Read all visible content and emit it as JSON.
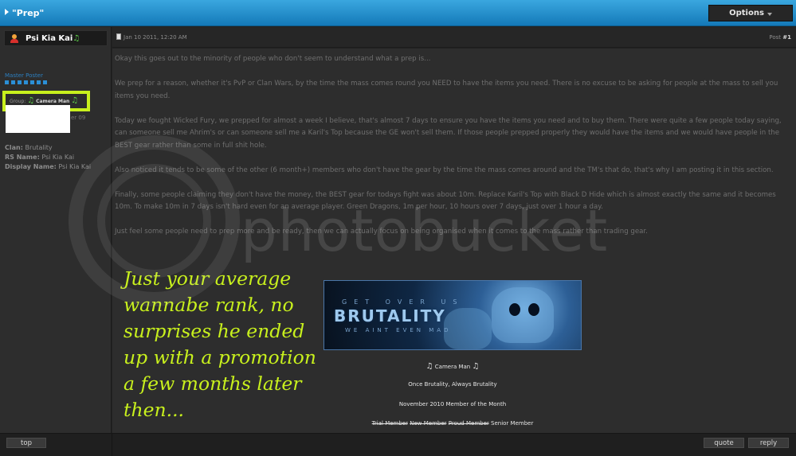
{
  "thread": {
    "title": "\"Prep\"",
    "options_label": "Options"
  },
  "user": {
    "name": "Psi Kia Kai",
    "title": "Master Poster",
    "group_label": "Group:",
    "group_value": "Camera Man",
    "joined_fragment": "er 09",
    "clan_label": "Clan:",
    "clan_value": "Brutality",
    "rs_label": "RS Name:",
    "rs_value": "Psi Kia Kai",
    "display_label": "Display Name:",
    "display_value": "Psi Kia Kai"
  },
  "post": {
    "date": "Jan 10 2011, 12:20 AM",
    "number_label": "Post",
    "number_value": "#1",
    "paragraphs": [
      "Okay this goes out to the minority of people who don't seem to understand what a prep is...",
      "We prep for a reason, whether it's PvP or Clan Wars, by the time the mass comes round you NEED to have the items you need. There is no excuse to be asking for people at the mass to sell you items you need.",
      "Today we fought Wicked Fury, we prepped for almost a week I believe, that's almost 7 days to ensure you have the items you need and to buy them. There were quite a few people today saying, can someone sell me Ahrim's or can someone sell me a Karil's Top because the GE won't sell them. If those people prepped properly they would have the items and we would have people in the BEST gear rather than some in full shit hole.",
      "Also noticed it tends to be some of the other (6 month+) members who don't have the gear by the time the mass comes around and the TM's that do, that's why I am posting it in this section.",
      "Finally, some people claiming they don't have the money, the BEST gear for todays fight was about 10m. Replace Karil's Top with Black D Hide which is almost exactly the same and it becomes 10m. To make 10m in 7 days isn't hard even for an average player. Green Dragons, 1m per hour, 10 hours over 7 days, just over 1 hour a day.",
      "Just feel some people need to prep more and be ready, then we can actually focus on being organised when it comes to the mass rather than trading gear."
    ]
  },
  "annotation": "Just your average wannabe rank, no surprises he ended up with a promotion a few months later then...",
  "banner": {
    "top_text": "GET OVER US",
    "main_text": "BRUTALITY",
    "sub_text": "WE AINT EVEN MAD"
  },
  "signature": {
    "rank": "Camera Man",
    "motto": "Once Brutality, Always Brutality",
    "award": "November 2010 Member of the Month",
    "ranks_struck": [
      "Trial Member",
      "New Member",
      "Proud Member"
    ],
    "rank_current": "Senior Member"
  },
  "watermark": "photobucket",
  "footer": {
    "top_label": "top",
    "quote_label": "quote",
    "reply_label": "reply"
  },
  "colors": {
    "accent_blue": "#1f8fd2",
    "highlight": "#c8f01d",
    "background": "#2d2d2d"
  }
}
